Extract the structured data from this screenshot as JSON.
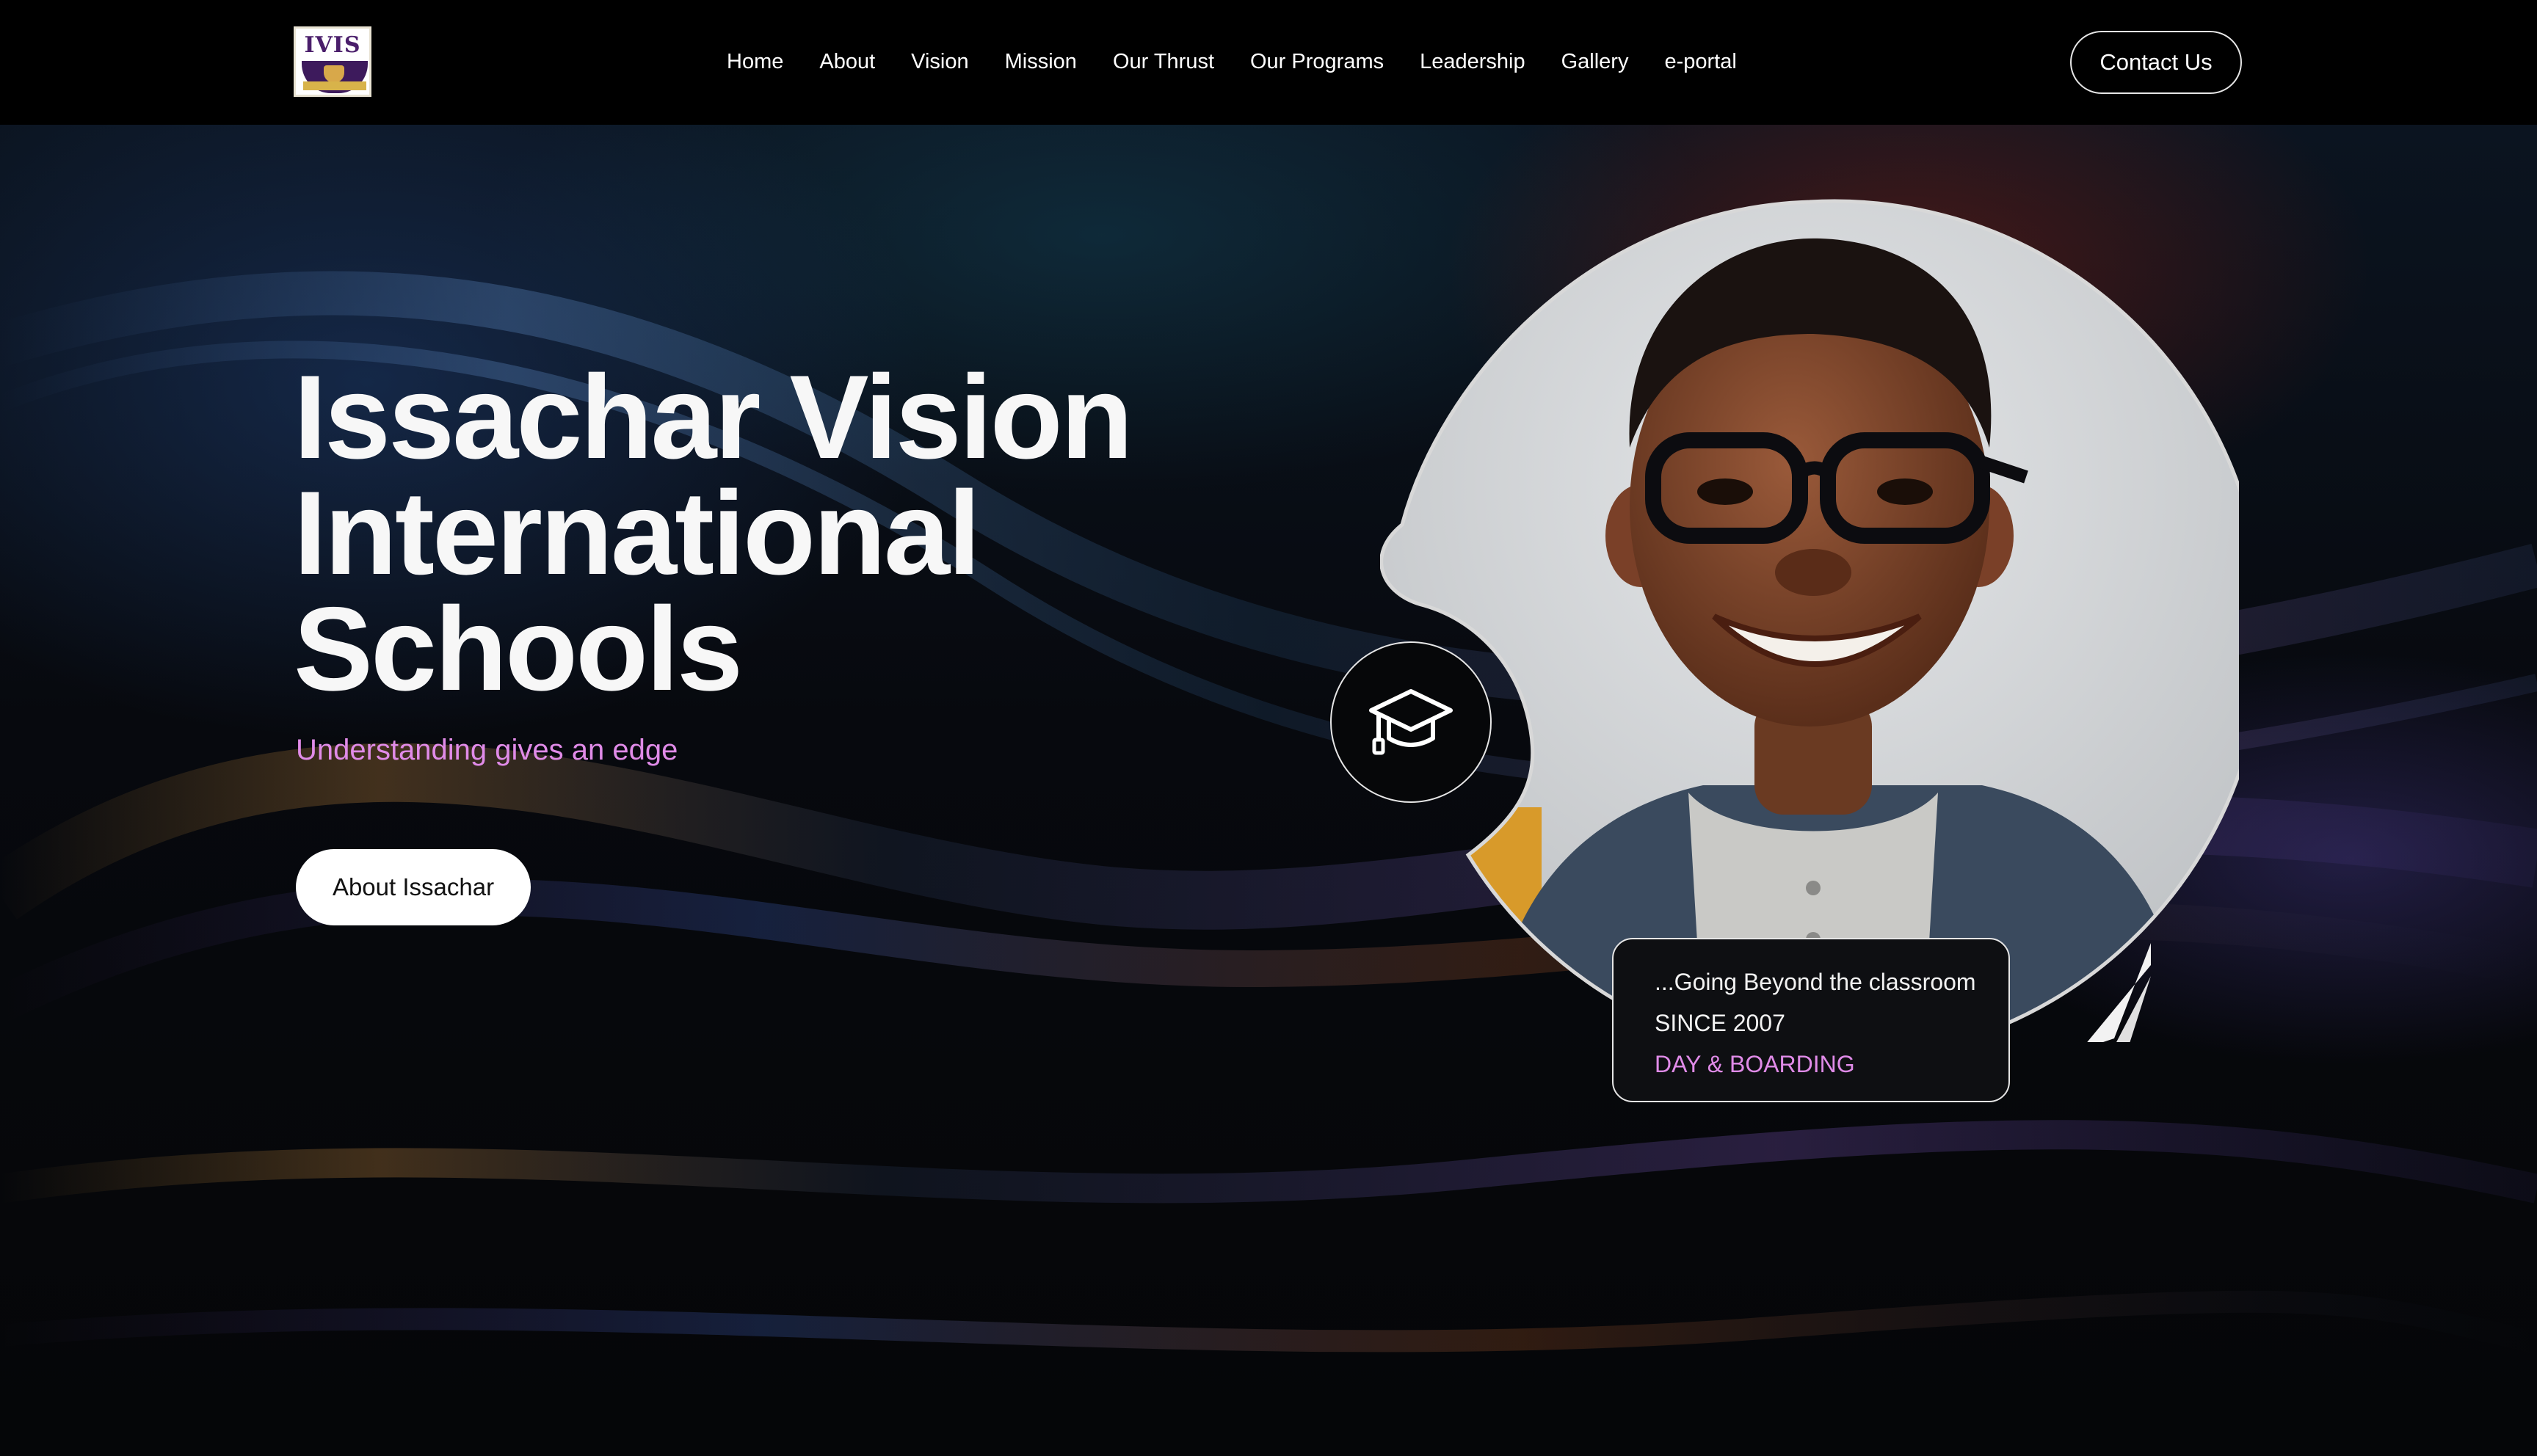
{
  "logo": {
    "text": "IVIS"
  },
  "nav": {
    "items": [
      "Home",
      "About",
      "Vision",
      "Mission",
      "Our Thrust",
      "Our Programs",
      "Leadership",
      "Gallery",
      "e-portal"
    ],
    "contact_label": "Contact Us"
  },
  "hero": {
    "title": "Issachar Vision International Schools",
    "subtitle": "Understanding gives an edge",
    "cta_label": "About Issachar"
  },
  "card": {
    "line1": "...Going Beyond the classroom",
    "line2": "SINCE 2007",
    "line3": "DAY & BOARDING"
  },
  "colors": {
    "accent": "#e08be8",
    "background": "#050608",
    "navbar": "#000000",
    "button": "#ffffff"
  },
  "icons": {
    "badge": "graduation-cap-icon"
  }
}
